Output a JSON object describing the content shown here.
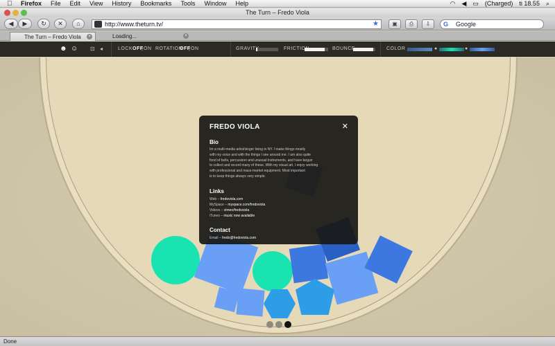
{
  "menubar": {
    "app": "Firefox",
    "menus": [
      "File",
      "Edit",
      "View",
      "History",
      "Bookmarks",
      "Tools",
      "Window",
      "Help"
    ],
    "battery": "(Charged)",
    "clock": "ti 18.55"
  },
  "window": {
    "title": "The Turn – Fredo Viola"
  },
  "toolbar": {
    "url": "http://www.theturn.tv/",
    "search_placeholder": "Google",
    "search_engine": "G"
  },
  "tabs": [
    {
      "label": "The Turn – Fredo Viola"
    },
    {
      "label": "Loading..."
    }
  ],
  "controls": {
    "lock_label": "LOCK",
    "lock_off": "OFF",
    "lock_sep": "|",
    "lock_on": "ON",
    "rotation_label": "ROTATION",
    "rotation_off": "OFF",
    "rotation_on": "ON",
    "gravity_label": "GRAVITY",
    "gravity_value": 0.05,
    "friction_label": "FRICTION",
    "friction_value": 0.85,
    "bounce_label": "BOUNCE",
    "bounce_value": 0.9,
    "color_label": "COLOR"
  },
  "modal": {
    "title": "FREDO VIOLA",
    "close": "✕",
    "bio_heading": "Bio",
    "bio_lines": [
      "Im a multi-media artist/singer living in NY. I make things mostly",
      "with my voice and with the things I see around me. I am also quite",
      "fond of bells, percussion and unusual instruments, and have begun",
      "to collect and record many of these. With my visual art, I enjoy working",
      "with professional and mass-market equipment. Most important",
      "is to keep things always very simple."
    ],
    "links_heading": "Links",
    "links": [
      {
        "label": "Web – ",
        "value": "fredoviola.com"
      },
      {
        "label": "MySpace – ",
        "value": "myspace.com/fredoviola"
      },
      {
        "label": "Videos – ",
        "value": "vimeo/fredoviola"
      },
      {
        "label": "iTunes – ",
        "value": "music now available"
      }
    ],
    "contact_heading": "Contact",
    "contact": {
      "label": "Email – ",
      "value": "fredo@fredoviola.com"
    }
  },
  "pager": {
    "pages": 3,
    "current": 3
  },
  "status": {
    "text": "Done"
  },
  "colors": {
    "teal": "#19e3b0",
    "blue_light": "#69a0f5",
    "blue_mid": "#3d78e0",
    "blue_dark": "#2a5fc4",
    "sky": "#2e9de8"
  }
}
